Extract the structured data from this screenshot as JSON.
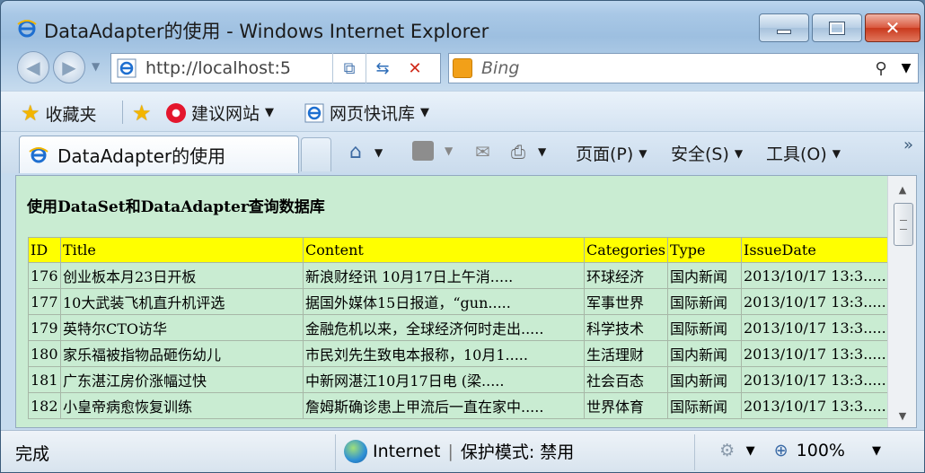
{
  "window": {
    "title": "DataAdapter的使用 - Windows Internet Explorer",
    "minimize_glyph": "—",
    "close_glyph": "✕"
  },
  "address": {
    "url": "http://localhost:5",
    "back_glyph": "◀",
    "forward_glyph": "▶"
  },
  "search": {
    "placeholder": "Bing"
  },
  "favorites": {
    "favorites_label": "收藏夹",
    "suggested_sites": "建议网站",
    "web_slice": "网页快讯库"
  },
  "tab": {
    "label": "DataAdapter的使用"
  },
  "commands": {
    "page": "页面(P)",
    "safety": "安全(S)",
    "tools": "工具(O)"
  },
  "page": {
    "heading": "使用DataSet和DataAdapter查询数据库",
    "table": {
      "headers": [
        "ID",
        "Title",
        "Content",
        "Categories",
        "Type",
        "IssueDate"
      ],
      "rows": [
        [
          "176",
          "创业板本月23日开板",
          "新浪财经讯 10月17日上午消.....",
          "环球经济",
          "国内新闻",
          "2013/10/17 13:3....."
        ],
        [
          "177",
          "10大武装飞机直升机评选",
          "据国外媒体15日报道，“gun.....",
          "军事世界",
          "国际新闻",
          "2013/10/17 13:3....."
        ],
        [
          "179",
          "英特尔CTO访华",
          "金融危机以来，全球经济何时走出.....",
          "科学技术",
          "国际新闻",
          "2013/10/17 13:3....."
        ],
        [
          "180",
          "家乐福被指物品砸伤幼儿",
          "市民刘先生致电本报称，10月1.....",
          "生活理财",
          "国内新闻",
          "2013/10/17 13:3....."
        ],
        [
          "181",
          "广东湛江房价涨幅过快",
          "中新网湛江10月17日电 (梁.....",
          "社会百态",
          "国内新闻",
          "2013/10/17 13:3....."
        ],
        [
          "182",
          "小皇帝病愈恢复训练",
          "詹姆斯确诊患上甲流后一直在家中.....",
          "世界体育",
          "国际新闻",
          "2013/10/17 13:3....."
        ]
      ]
    }
  },
  "status": {
    "text": "完成",
    "zone": "Internet",
    "protected_mode": "保护模式: 禁用",
    "zoom": "100%"
  },
  "colors": {
    "page_background": "#c9ecd2",
    "header_row": "#ffff00"
  }
}
